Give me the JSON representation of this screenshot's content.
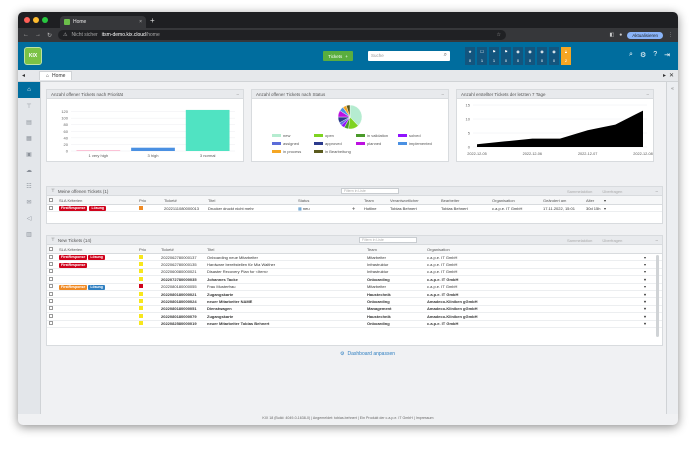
{
  "browser": {
    "tab_title": "Home",
    "close": "×",
    "new_tab": "+",
    "security": "Nicht sicher",
    "url_host": "itsm-demo.kix.cloud",
    "url_path": "/home",
    "update_label": "Aktualisieren",
    "colors": {
      "red": "#ff5f57",
      "yellow": "#febc2e",
      "green": "#28c840"
    }
  },
  "header": {
    "logo": "KIX",
    "tickets_btn": "Tickets",
    "search_placeholder": "Suche",
    "stats": [
      {
        "icon": "★",
        "value": "0"
      },
      {
        "icon": "☐",
        "value": "1"
      },
      {
        "icon": "⚑",
        "value": "1"
      },
      {
        "icon": "⚑",
        "value": "0"
      },
      {
        "icon": "◉",
        "value": "0"
      },
      {
        "icon": "◉",
        "value": "0"
      },
      {
        "icon": "◉",
        "value": "0"
      },
      {
        "icon": "◉",
        "value": "0"
      }
    ],
    "lock_value": "2"
  },
  "breadcrumb": {
    "home": "Home"
  },
  "widgets": {
    "prio": {
      "title": "Anzahl offener Tickets nach Priorität"
    },
    "status": {
      "title": "Anzahl offener Tickets nach Status"
    },
    "days": {
      "title": "Anzahl erstellter Tickets der letzten 7 Tage"
    }
  },
  "chart_data": [
    {
      "type": "bar",
      "title": "Anzahl offener Tickets nach Priorität",
      "categories": [
        "1 very high",
        "3 high",
        "3 normal"
      ],
      "values": [
        2,
        10,
        125
      ],
      "colors": [
        "#f9a3c0",
        "#4a90e2",
        "#50e3c2"
      ],
      "ylim": [
        0,
        140
      ],
      "yticks": [
        0,
        20,
        40,
        60,
        80,
        100,
        120
      ]
    },
    {
      "type": "pie",
      "title": "Anzahl offener Tickets nach Status",
      "series": [
        {
          "name": "new",
          "value": 38,
          "color": "#b5ecd0"
        },
        {
          "name": "open",
          "value": 14,
          "color": "#7ed321"
        },
        {
          "name": "in validation",
          "value": 6,
          "color": "#4a9a2a"
        },
        {
          "name": "solved",
          "value": 5,
          "color": "#9013fe"
        },
        {
          "name": "assigned",
          "value": 4,
          "color": "#5b6cd9"
        },
        {
          "name": "approved",
          "value": 8,
          "color": "#2b3a8c"
        },
        {
          "name": "planned",
          "value": 9,
          "color": "#bd10e0"
        },
        {
          "name": "implemented",
          "value": 6,
          "color": "#4a90e2"
        },
        {
          "name": "in process",
          "value": 5,
          "color": "#f5a623"
        },
        {
          "name": "in Bearbeitung",
          "value": 5,
          "color": "#5a5a1e"
        }
      ]
    },
    {
      "type": "area",
      "title": "Anzahl erstellter Tickets der letzten 7 Tage",
      "x": [
        "2022-12-05",
        "2022-12-06",
        "2022-12-06",
        "2022-12-07",
        "2022-12-07",
        "2022-12-08",
        "2022-12-08"
      ],
      "values": [
        1,
        2,
        3,
        3,
        6,
        8,
        13
      ],
      "xticks": [
        "2022-12-05",
        "2022-12-06",
        "2022-12-07",
        "2022-12-08"
      ],
      "ylim": [
        0,
        15
      ],
      "yticks": [
        0,
        5,
        10,
        15
      ],
      "color": "#000000"
    }
  ],
  "my_tickets": {
    "title": "Meine offenen Tickets (1)",
    "filter_placeholder": "Filtern in Liste",
    "action1": "Sammelaktion",
    "action2": "Überfragen",
    "columns": [
      "SLA Kriterien",
      "Prio",
      "Ticket#",
      "Titel",
      "Status",
      "",
      "Team",
      "Verantwortlicher",
      "Bearbeiter",
      "Organisation",
      "Geändert am",
      "Alter"
    ],
    "rows": [
      {
        "sla1": "FirstResponse",
        "sla2": "Lösung",
        "ticket": "2022111080000013",
        "title": "Drucker druckt nicht mehr",
        "status": "neu",
        "team": "Hotline",
        "owner": "Tobias Behnert",
        "agent": "Tobias Behnert",
        "org": "c.a.p.e. IT GmbH",
        "changed": "17.11.2022, 15:01",
        "age": "30d 15h"
      }
    ]
  },
  "new_tickets": {
    "title": "New Tickets (14)",
    "filter_placeholder": "Filtern in Liste",
    "action1": "Sammelaktion",
    "action2": "Überfragen",
    "columns": [
      "SLA Kriterien",
      "Prio",
      "Ticket#",
      "Titel",
      "Team",
      "Organisation"
    ],
    "rows": [
      {
        "sla1": "FirstResponse",
        "sla2": "Lösung",
        "prio": "#f8e71c",
        "ticket": "2022062780000137",
        "title": "Onboarding neue Mitarbeiter",
        "team": "Mitarbeiter",
        "org": "c.a.p.e. IT GmbH",
        "bold": false
      },
      {
        "sla1": "FirstResponse",
        "sla2": "",
        "prio": "#f8e71c",
        "ticket": "2022062780000135",
        "title": "Hardware bereitstellen für Mia Walther",
        "team": "Infrastruktur",
        "org": "c.a.p.e. IT GmbH",
        "bold": false
      },
      {
        "sla1": "",
        "sla2": "",
        "prio": "#f8e71c",
        "ticket": "2022060080000021",
        "title": "Disaster Recovery Plan for <Item>",
        "team": "Infrastruktur",
        "org": "c.a.p.e. IT GmbH",
        "bold": false
      },
      {
        "sla1": "",
        "sla2": "",
        "prio": "#f8e71c",
        "ticket": "2022072780000035",
        "title": "Johannes Tacke",
        "team": "Onboarding",
        "org": "c.a.p.e. IT GmbH",
        "bold": true
      },
      {
        "sla1": "FirstResponse",
        "sla2": "Lösung",
        "prio": "#d0021b",
        "ticket": "2022080180000055",
        "title": "Frau Musterfrau",
        "team": "Mitarbeiter",
        "org": "c.a.p.e. IT GmbH",
        "bold": false
      },
      {
        "sla1": "",
        "sla2": "",
        "prio": "#f8e71c",
        "ticket": "2022080180000021",
        "title": "Zugangskarte",
        "team": "Haustechnik",
        "org": "c.a.p.e. IT GmbH",
        "bold": true
      },
      {
        "sla1": "",
        "sla2": "",
        "prio": "#f8e71c",
        "ticket": "2022080180000024",
        "title": "neuer Mitarbeiter NAME",
        "team": "Onboarding",
        "org": "Amadeco-Kliniken gGmbH",
        "bold": true
      },
      {
        "sla1": "",
        "sla2": "",
        "prio": "#f8e71c",
        "ticket": "2022080180000051",
        "title": "Dienstwagen",
        "team": "Management",
        "org": "Amadeco-Kliniken gGmbH",
        "bold": true
      },
      {
        "sla1": "",
        "sla2": "",
        "prio": "#f8e71c",
        "ticket": "2022080180000079",
        "title": "Zugangskarte",
        "team": "Haustechnik",
        "org": "Amadeco-Kliniken gGmbH",
        "bold": true
      },
      {
        "sla1": "",
        "sla2": "",
        "prio": "#f8e71c",
        "ticket": "2022082580000019",
        "title": "neuer Mitarbeiter Tobias Behnert",
        "team": "Onboarding",
        "org": "c.a.p.e. IT GmbH",
        "bold": true
      }
    ]
  },
  "dashboard_link": "Dashboard anpassen",
  "footer": "KIX 18 (Build: 4049-0-1638-0) | Angemeldet: tobias.behnert | Ein Produkt der c.a.p.e. IT GmbH | Impressum"
}
